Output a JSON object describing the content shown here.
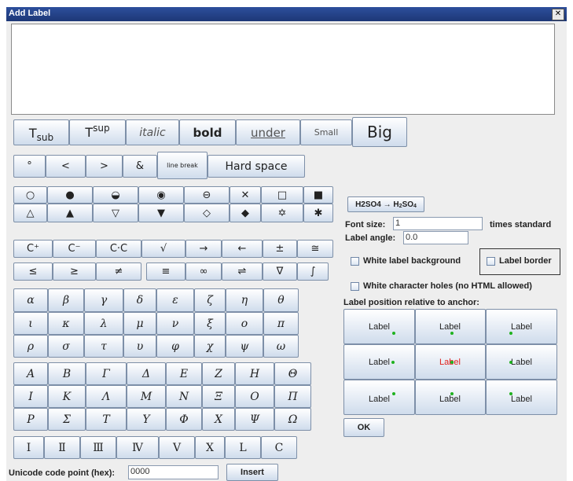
{
  "window": {
    "title": "Add Label",
    "close_symbol": "✕"
  },
  "format_row": [
    {
      "name": "tsub-button",
      "label_main": "T",
      "label_part": "sub",
      "style": "sub"
    },
    {
      "name": "tsup-button",
      "label_main": "T",
      "label_part": "sup",
      "style": "sup"
    },
    {
      "name": "italic-button",
      "label": "italic",
      "style": "italic"
    },
    {
      "name": "bold-button",
      "label": "bold",
      "style": "bold"
    },
    {
      "name": "underline-button",
      "label": "under",
      "style": "under"
    },
    {
      "name": "small-button",
      "label": "Small",
      "style": "small"
    },
    {
      "name": "big-button",
      "label": "Big",
      "style": "big"
    }
  ],
  "special_row": [
    "°",
    "<",
    ">",
    "&",
    "line break",
    "Hard space"
  ],
  "shapes_row1": [
    "○",
    "●",
    "◒",
    "◉",
    "⊖",
    "✕",
    "□",
    "■"
  ],
  "shapes_row2": [
    "△",
    "▲",
    "▽",
    "▼",
    "◇",
    "◆",
    "✡",
    "✱"
  ],
  "math_row1": [
    "C⁺",
    "C⁻",
    "C·C",
    "√",
    "→",
    "←",
    "±",
    "≅"
  ],
  "math_row2": [
    "≤",
    "≥",
    "≠",
    "≡",
    "∞",
    "⇌",
    "∇",
    "∫"
  ],
  "greek_lower1": [
    "α",
    "β",
    "γ",
    "δ",
    "ε",
    "ζ",
    "η",
    "θ"
  ],
  "greek_lower2": [
    "ι",
    "κ",
    "λ",
    "μ",
    "ν",
    "ξ",
    "ο",
    "π"
  ],
  "greek_lower3": [
    "ρ",
    "σ",
    "τ",
    "υ",
    "φ",
    "χ",
    "ψ",
    "ω"
  ],
  "greek_upper1": [
    "A",
    "B",
    "Γ",
    "Δ",
    "E",
    "Z",
    "H",
    "Θ"
  ],
  "greek_upper2": [
    "I",
    "K",
    "Λ",
    "M",
    "N",
    "Ξ",
    "O",
    "Π"
  ],
  "greek_upper3": [
    "P",
    "Σ",
    "T",
    "Y",
    "Φ",
    "X",
    "Ψ",
    "Ω"
  ],
  "roman_row": [
    "I",
    "Ⅱ",
    "Ⅲ",
    "Ⅳ",
    "V",
    "X",
    "L",
    "C"
  ],
  "unicode": {
    "label": "Unicode code point (hex):",
    "value": "0000",
    "insert_label": "Insert"
  },
  "formula_button": {
    "left": "H2SO4",
    "arrow": "→",
    "right_a": "H",
    "right_sub1": "2",
    "right_b": "SO",
    "right_sub2": "4"
  },
  "font_size": {
    "label": "Font size:",
    "value": "1",
    "suffix": "times standard"
  },
  "label_angle": {
    "label": "Label angle:",
    "value": "0.0"
  },
  "options": {
    "white_bg": "White label background",
    "border": "Label border",
    "holes": "White character holes (no HTML allowed)"
  },
  "position": {
    "heading": "Label position relative to anchor:",
    "cell_label": "Label",
    "selected_color": "#e0201a",
    "dot_color": "#1fb21f"
  },
  "ok_label": "OK"
}
